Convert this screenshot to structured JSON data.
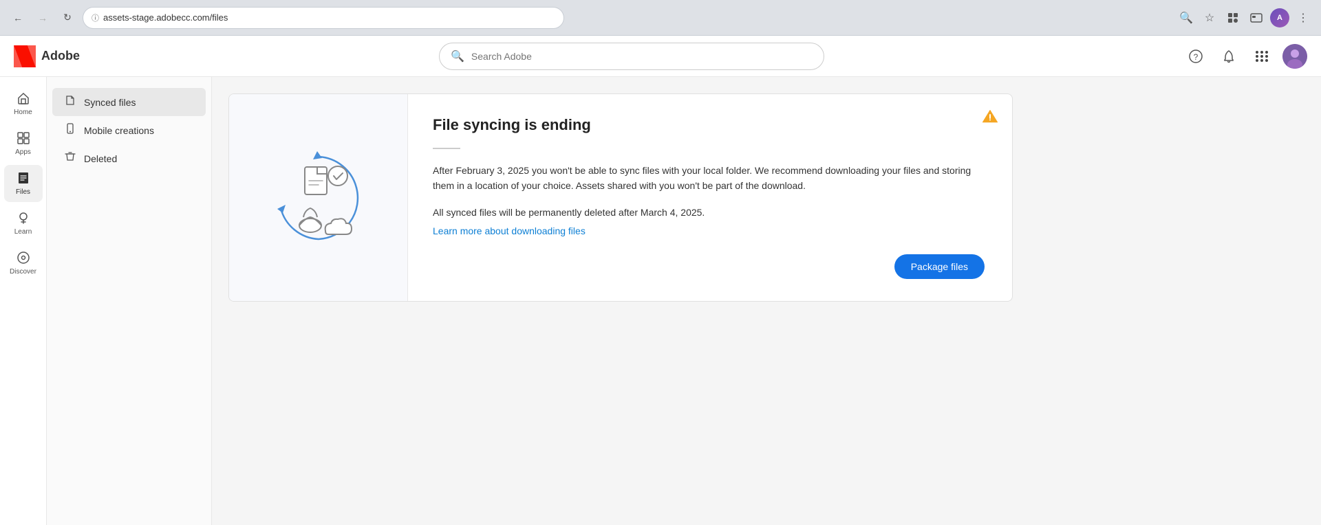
{
  "browser": {
    "back_disabled": false,
    "forward_disabled": true,
    "url": "assets-stage.adobecc.com/files"
  },
  "header": {
    "logo_text": "Adobe",
    "search_placeholder": "Search Adobe",
    "help_icon": "?",
    "notification_icon": "🔔",
    "grid_icon": "grid",
    "user_initials": "A"
  },
  "sidebar": {
    "items": [
      {
        "id": "home",
        "label": "Home",
        "icon": "⌂",
        "active": false
      },
      {
        "id": "apps",
        "label": "Apps",
        "icon": "⊞",
        "active": false
      },
      {
        "id": "files",
        "label": "Files",
        "icon": "📁",
        "active": true
      },
      {
        "id": "learn",
        "label": "Learn",
        "icon": "💡",
        "active": false
      },
      {
        "id": "discover",
        "label": "Discover",
        "icon": "◎",
        "active": false
      }
    ]
  },
  "nav_panel": {
    "items": [
      {
        "id": "synced-files",
        "label": "Synced files",
        "icon": "📄",
        "active": true
      },
      {
        "id": "mobile-creations",
        "label": "Mobile creations",
        "icon": "📱",
        "active": false
      },
      {
        "id": "deleted",
        "label": "Deleted",
        "icon": "🗑",
        "active": false
      }
    ]
  },
  "banner": {
    "title": "File syncing is ending",
    "body_text": "After February 3, 2025 you won't be able to sync files with your local folder. We recommend downloading your files and storing them in a location of your choice. Assets shared with you won't be part of the download.",
    "secondary_text": "All synced files will be permanently deleted after March 4, 2025.",
    "link_text": "Learn more about downloading files",
    "link_url": "#",
    "package_btn_label": "Package files",
    "warning_icon": "⚠️"
  }
}
